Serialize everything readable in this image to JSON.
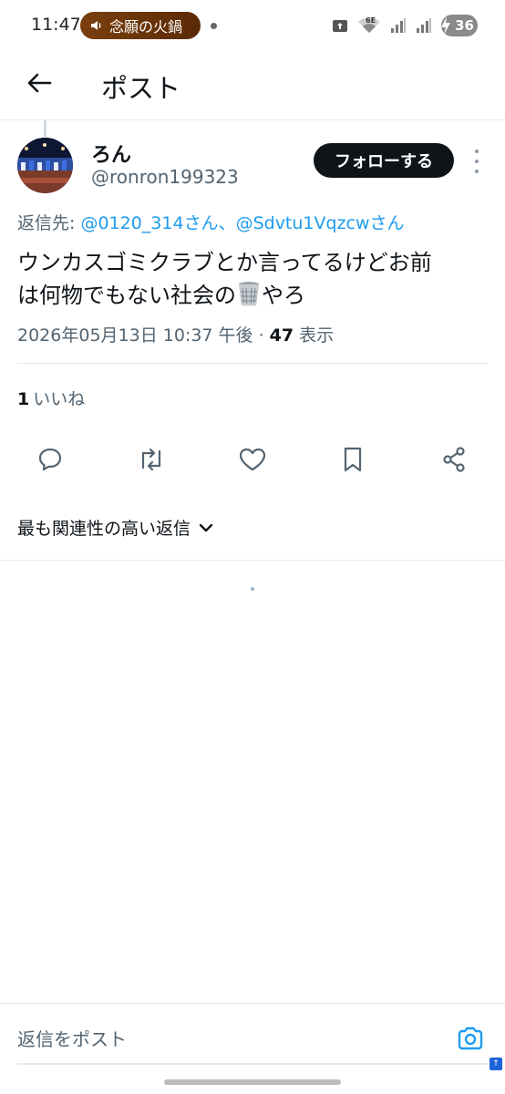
{
  "status_bar": {
    "time": "11:47",
    "media_title": "念願の火鍋",
    "battery": "36",
    "network_label": "6E"
  },
  "header": {
    "title": "ポスト"
  },
  "post": {
    "author_name": "ろん",
    "author_handle": "@ronron199323",
    "follow_label": "フォローする",
    "reply_prefix": "返信先: ",
    "reply_mentions": "@0120_314さん、@Sdvtu1Vqzcwさん",
    "text_line1": "ウンカスゴミクラブとか言ってるけどお前",
    "text_line2_before": "は何物でもない社会の",
    "text_line2_after": "やろ",
    "timestamp": "2026年05月13日 10:37 午後 · ",
    "views_count": "47",
    "views_label": " 表示",
    "likes_count": "1",
    "likes_label": "いいね"
  },
  "actions": {
    "reply_icon": "comment-icon",
    "retweet_icon": "retweet-icon",
    "like_icon": "heart-icon",
    "bookmark_icon": "bookmark-icon",
    "share_icon": "share-icon"
  },
  "replies": {
    "sort_label": "最も関連性の高い返信"
  },
  "composer": {
    "placeholder": "返信をポスト"
  },
  "colors": {
    "accent": "#1d9bf0",
    "text_primary": "#0f1419",
    "text_secondary": "#536471",
    "button_dark": "#0f1419"
  }
}
